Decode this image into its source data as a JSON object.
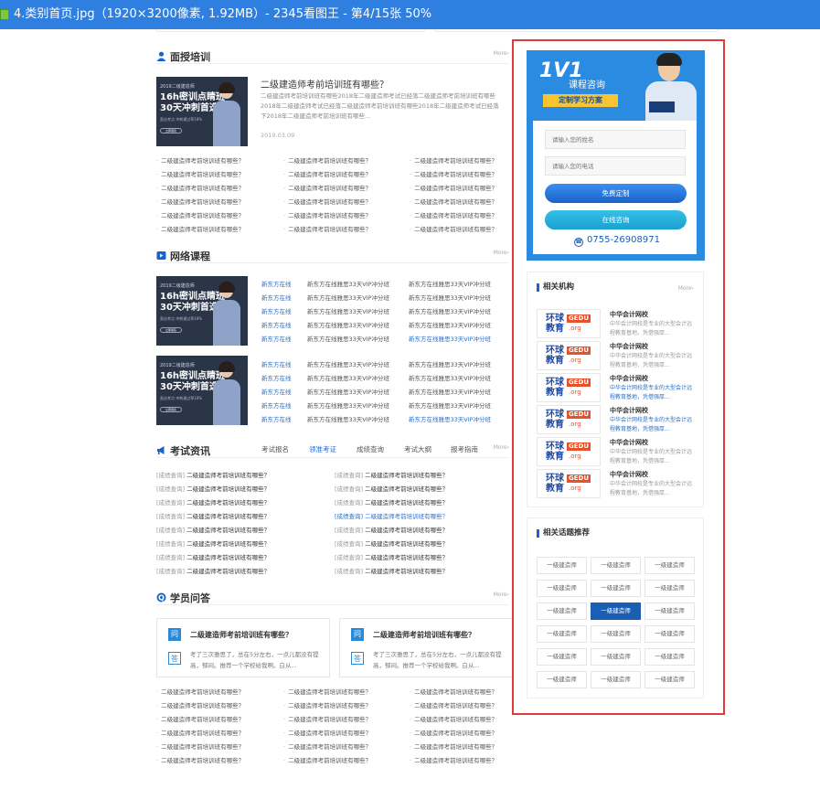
{
  "window": {
    "title": "4.类别首页.jpg（1920×3200像素, 1.92MB）- 2345看图王 - 第4/15张 50%"
  },
  "common": {
    "more": "More›",
    "item": "二级建造师考前培训班有哪些？",
    "banner": {
      "tag": "2019二级建造师",
      "l1": "16h密训点睛班",
      "l2": "30天冲刺首选",
      "small": "直击考点 冲刺通过率18%",
      "btn": "立即报名"
    }
  },
  "face_training": {
    "title": "面授培训",
    "article": {
      "title": "二级建造师考前培训班有哪些？",
      "desc": "二级建造师考前培训班有哪些2018年二级建造师考试已经落二级建造师考前培训班有哪些2018年二级建造师考试已经落二级建造师考前培训班有哪些2018年二级建造师考试已经落下2018年二级建造师考前培训班有哪些...",
      "date": "2019.03.09"
    }
  },
  "online_courses": {
    "title": "网络课程",
    "rows": [
      [
        "新东方在线",
        "新东方在线雅思33天VIP冲分班",
        "新东方在线雅思33天VIP冲分班"
      ],
      [
        "新东方在线",
        "新东方在线雅思33天VIP冲分班",
        "新东方在线雅思33天VIP冲分班"
      ],
      [
        "新东方在线",
        "新东方在线雅思33天VIP冲分班",
        "新东方在线雅思33天VIP冲分班"
      ],
      [
        "新东方在线",
        "新东方在线雅思33天VIP冲分班",
        "新东方在线雅思33天VIP冲分班"
      ],
      [
        "新东方在线",
        "新东方在线雅思33天VIP冲分班",
        "新东方在线雅思33天VIP冲分班"
      ]
    ]
  },
  "exam_news": {
    "title": "考试资讯",
    "tabs": [
      "考试报名",
      "领准考证",
      "成绩查询",
      "考试大纲",
      "报考指南"
    ],
    "category": "[成绩查询]",
    "headline": "二级建造师考前培训班有哪些？"
  },
  "student_qa": {
    "title": "学员问答",
    "q_icon": "问",
    "a_icon": "答",
    "question": "二级建造师考前培训班有哪些？",
    "answer": "考了三次雅思了，总在5分左右，一点儿都没有提高，郁闷。推荐一个学校给我啊。白从..."
  },
  "consult": {
    "brand": "1V1",
    "title": "课程咨询",
    "subtitle": "定制学习方案",
    "name_placeholder": "请输入您的姓名",
    "phone_placeholder": "请输入您的电话",
    "btn_free": "免费定制",
    "btn_online": "在线咨询",
    "phone": "0755-26908971"
  },
  "institutions": {
    "title": "相关机构",
    "more": "More›",
    "logo": {
      "a": "环球教育",
      "b": "GEDU",
      "c": ".org"
    },
    "name": "中华会计网校",
    "desc": "中华会计网校是专业的大型会计远程教育基地，凭借强厚..."
  },
  "topics": {
    "title": "相关话题推荐",
    "tag": "一级建造师"
  }
}
